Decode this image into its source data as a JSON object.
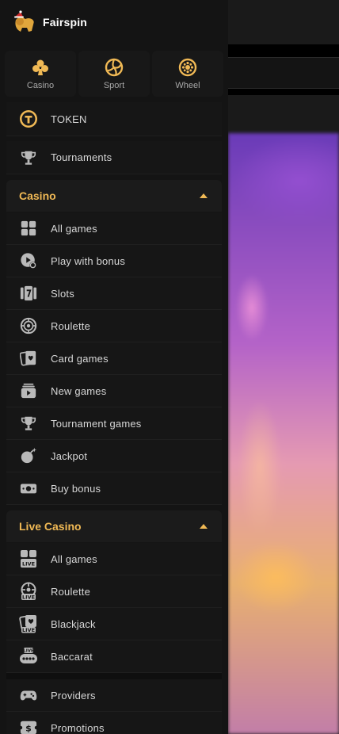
{
  "brand": {
    "name": "Fairspin"
  },
  "quick_tiles": [
    {
      "label": "Casino",
      "icon": "clubs-icon"
    },
    {
      "label": "Sport",
      "icon": "volleyball-icon"
    },
    {
      "label": "Wheel",
      "icon": "wheel-icon"
    }
  ],
  "top_items": [
    {
      "label": "TOKEN",
      "icon": "token-icon"
    },
    {
      "label": "Tournaments",
      "icon": "trophy-icon"
    }
  ],
  "casino": {
    "title": "Casino",
    "items": [
      {
        "label": "All games",
        "icon": "grid-icon"
      },
      {
        "label": "Play with bonus",
        "icon": "play-bonus-icon"
      },
      {
        "label": "Slots",
        "icon": "slots-icon"
      },
      {
        "label": "Roulette",
        "icon": "roulette-icon"
      },
      {
        "label": "Card games",
        "icon": "cards-icon"
      },
      {
        "label": "New games",
        "icon": "new-games-icon"
      },
      {
        "label": "Tournament games",
        "icon": "trophy-icon"
      },
      {
        "label": "Jackpot",
        "icon": "bomb-icon"
      },
      {
        "label": "Buy bonus",
        "icon": "cash-icon"
      }
    ]
  },
  "live_casino": {
    "title": "Live Casino",
    "items": [
      {
        "label": "All games",
        "icon": "live-grid-icon"
      },
      {
        "label": "Roulette",
        "icon": "live-roulette-icon"
      },
      {
        "label": "Blackjack",
        "icon": "live-cards-icon"
      },
      {
        "label": "Baccarat",
        "icon": "live-baccarat-icon"
      }
    ]
  },
  "bottom_items": [
    {
      "label": "Providers",
      "icon": "gamepad-icon"
    },
    {
      "label": "Promotions",
      "icon": "promo-icon"
    }
  ],
  "colors": {
    "accent": "#f0b955",
    "icon": "#b9b9b9",
    "panel": "#141414"
  }
}
